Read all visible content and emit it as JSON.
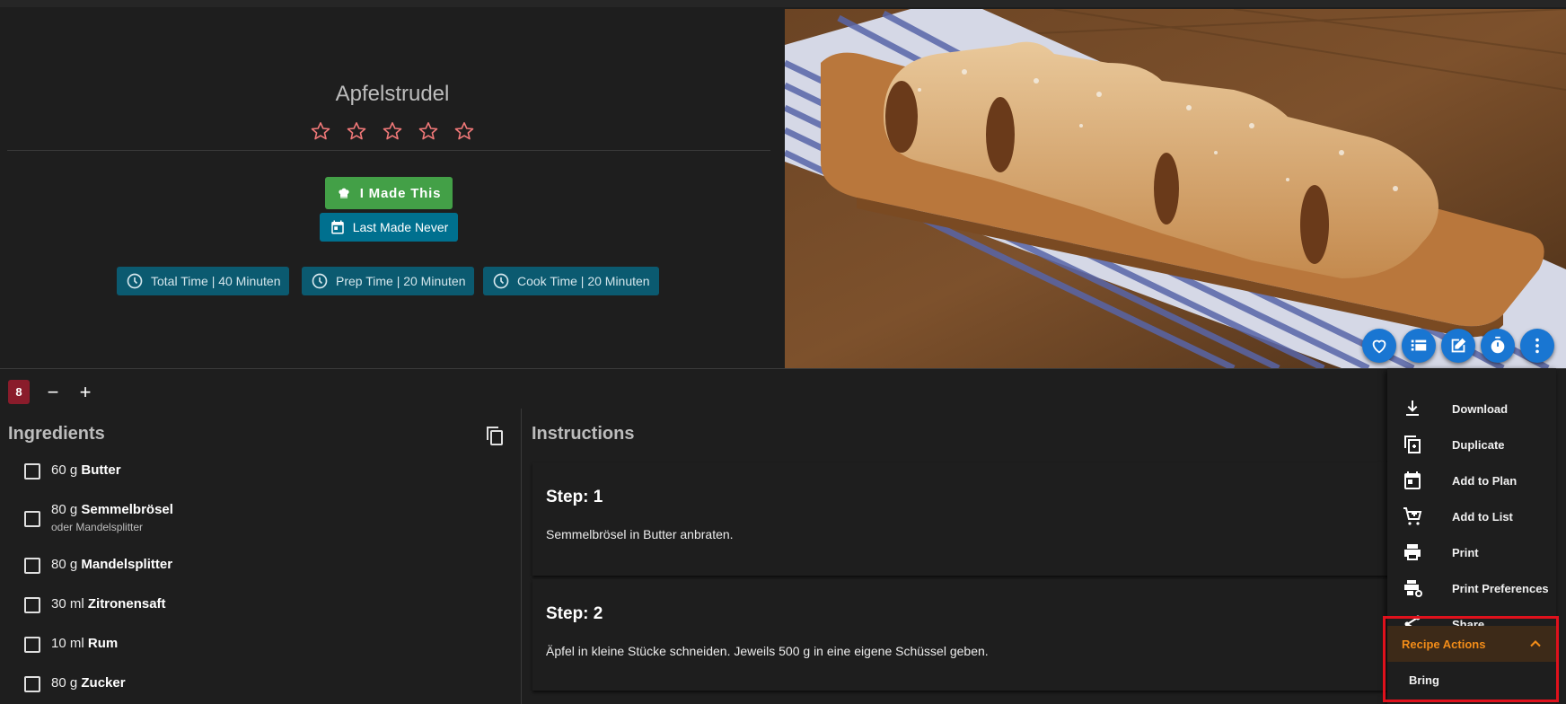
{
  "recipe": {
    "title": "Apfelstrudel",
    "rating": 0,
    "rating_max": 5,
    "made_this_label": "I Made This",
    "last_made_label": "Last Made Never",
    "times": {
      "total": "Total Time | 40 Minuten",
      "prep": "Prep Time | 20 Minuten",
      "cook": "Cook Time | 20 Minuten"
    }
  },
  "servings": {
    "count": "8",
    "minus": "−",
    "plus": "+"
  },
  "ingredients": {
    "title": "Ingredients",
    "items": [
      {
        "amount": "60 g",
        "name": "Butter",
        "note": ""
      },
      {
        "amount": "80 g",
        "name": "Semmelbrösel",
        "note": "oder Mandelsplitter"
      },
      {
        "amount": "80 g",
        "name": "Mandelsplitter",
        "note": ""
      },
      {
        "amount": "30 ml",
        "name": "Zitronensaft",
        "note": ""
      },
      {
        "amount": "10 ml",
        "name": "Rum",
        "note": ""
      },
      {
        "amount": "80 g",
        "name": "Zucker",
        "note": ""
      }
    ]
  },
  "instructions": {
    "title": "Instructions",
    "steps": [
      {
        "title": "Step: 1",
        "text": "Semmelbrösel in Butter anbraten."
      },
      {
        "title": "Step: 2",
        "text": "Äpfel in kleine Stücke schneiden. Jeweils 500 g in eine eigene Schüssel geben."
      }
    ]
  },
  "fab_icons": [
    "heart-icon",
    "list-icon",
    "edit-icon",
    "timer-icon",
    "more-vert-icon"
  ],
  "menu": {
    "items": [
      {
        "label": "Download",
        "icon": "download-icon"
      },
      {
        "label": "Duplicate",
        "icon": "duplicate-icon"
      },
      {
        "label": "Add to Plan",
        "icon": "calendar-icon"
      },
      {
        "label": "Add to List",
        "icon": "cart-icon"
      },
      {
        "label": "Print",
        "icon": "print-icon"
      },
      {
        "label": "Print Preferences",
        "icon": "print-settings-icon"
      },
      {
        "label": "Share",
        "icon": "share-icon"
      }
    ],
    "recipe_actions_label": "Recipe Actions",
    "recipe_actions_items": [
      "Bring"
    ]
  },
  "colors": {
    "made_this": "#43a047",
    "primary_chip": "#0b5a70",
    "fab": "#1976d2",
    "accent_orange": "#f28c18",
    "servings_badge": "#8a1c2b",
    "highlight": "#e0111c",
    "star": "#f07878"
  }
}
